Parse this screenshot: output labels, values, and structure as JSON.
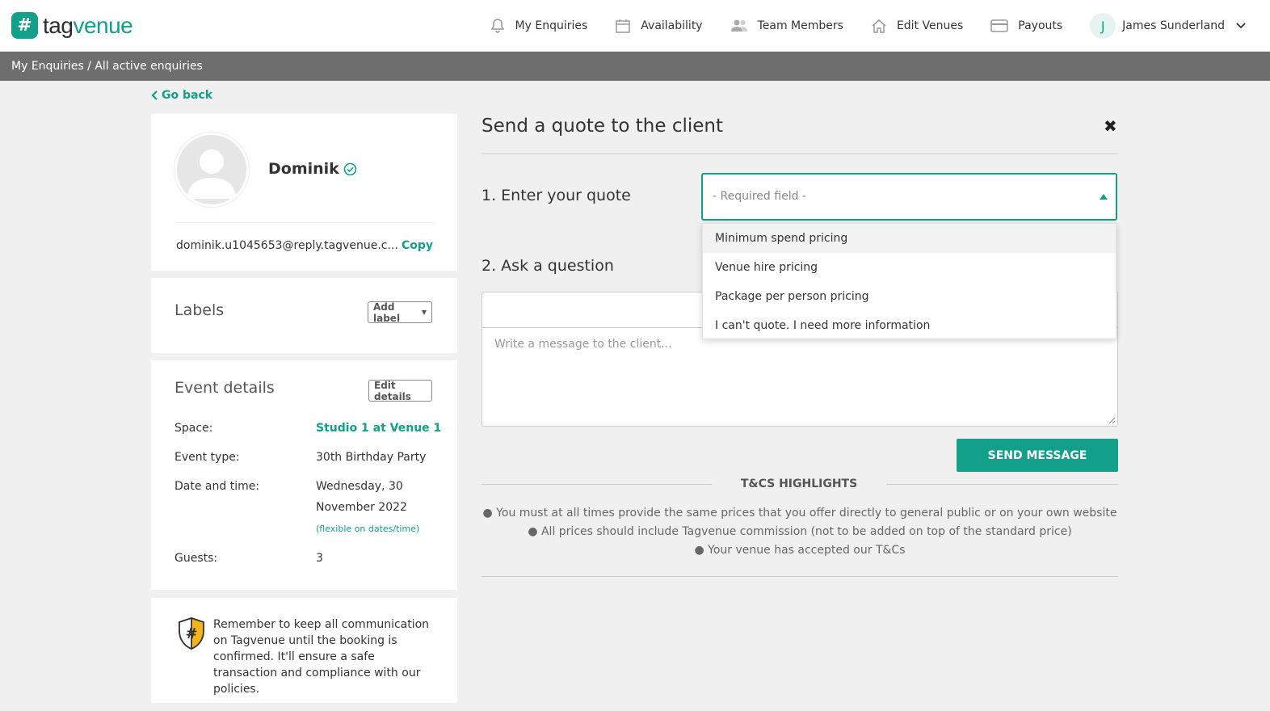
{
  "brand": {
    "name_part1": "tag",
    "name_part2": "venue",
    "logo_glyph": "#",
    "accent": "#12a08a"
  },
  "nav": {
    "items": [
      {
        "label": "My Enquiries",
        "icon": "bell-icon"
      },
      {
        "label": "Availability",
        "icon": "calendar-icon"
      },
      {
        "label": "Team Members",
        "icon": "users-icon"
      },
      {
        "label": "Edit Venues",
        "icon": "home-icon"
      },
      {
        "label": "Payouts",
        "icon": "credit-card-icon"
      }
    ],
    "user": {
      "initial": "J",
      "name": "James Sunderland"
    }
  },
  "breadcrumb": "My Enquiries / All active enquiries",
  "go_back": "Go back",
  "client": {
    "name": "Dominik",
    "email": "dominik.u1045653@reply.tagvenue.c...",
    "copy_label": "Copy"
  },
  "labels_panel": {
    "title": "Labels",
    "add_label": "Add label"
  },
  "event": {
    "title": "Event details",
    "edit_label": "Edit details",
    "space_label": "Space:",
    "space_value": "Studio 1 at Venue 1",
    "type_label": "Event type:",
    "type_value": "30th Birthday Party",
    "date_label": "Date and time:",
    "date_line1": "Wednesday, 30",
    "date_line2": "November 2022",
    "flexible": "(flexible on dates/time)",
    "guests_label": "Guests:",
    "guests_value": "3"
  },
  "notice": "Remember to keep all communication on Tagvenue until the booking is confirmed. It'll ensure a safe transaction and compliance with our policies.",
  "quote": {
    "title": "Send a quote to the client",
    "step1": "1. Enter your quote",
    "select_placeholder": "- Required field -",
    "options": [
      "Minimum spend pricing",
      "Venue hire pricing",
      "Package per person pricing",
      "I can't quote. I need more information"
    ],
    "step2": "2. Ask a question",
    "message_placeholder": "Write a message to the client...",
    "send_label": "SEND MESSAGE"
  },
  "tcs": {
    "title": "T&CS HIGHLIGHTS",
    "items": [
      "● You must at all times provide the same prices that you offer directly to general public or on your own website",
      "● All prices should include Tagvenue commission (not to be added on top of the standard price)",
      "● Your venue has accepted our T&Cs"
    ]
  }
}
